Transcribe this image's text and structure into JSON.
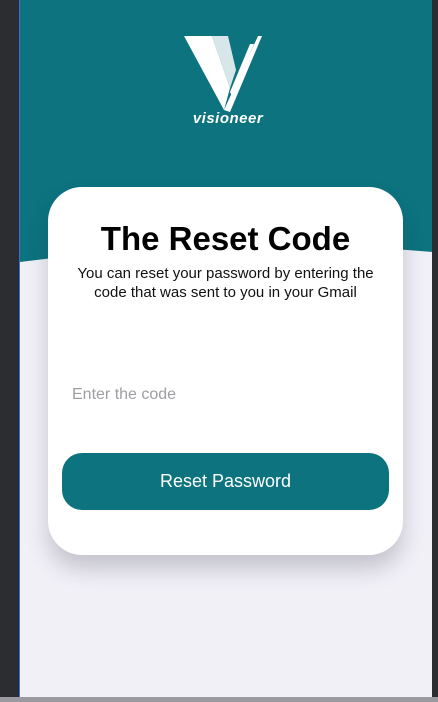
{
  "brand": {
    "name": "visioneer",
    "color": "#0c737f",
    "logo_icon": "v-logo-icon"
  },
  "card": {
    "title": "The Reset Code",
    "subtitle": "You can reset your password by entering the code that was sent to you in your Gmail"
  },
  "code_input": {
    "value": "",
    "placeholder": "Enter the code"
  },
  "reset_button": {
    "label": "Reset Password"
  }
}
